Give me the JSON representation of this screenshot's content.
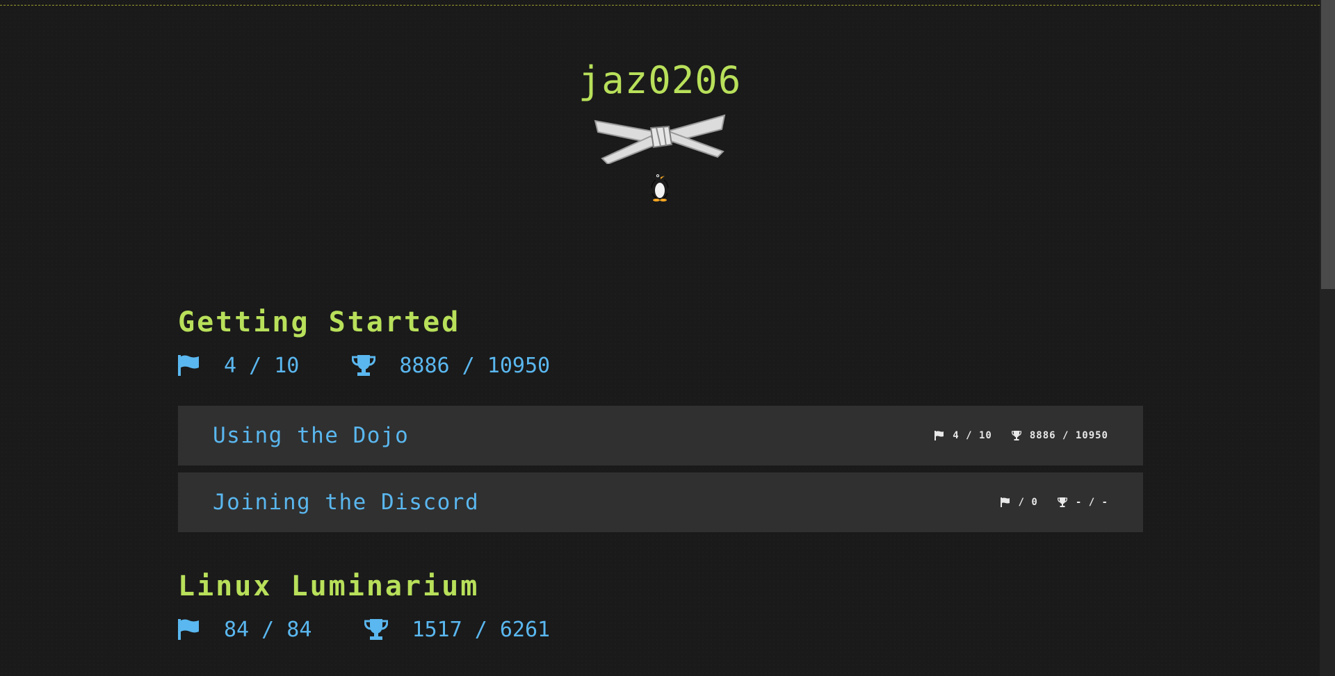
{
  "profile": {
    "username": "jaz0206",
    "belt_icon": "white-belt-icon",
    "emoji_icon": "penguin-icon"
  },
  "modules": [
    {
      "title": "Getting Started",
      "solved": "4 / 10",
      "points": "8886 / 10950",
      "challenges": [
        {
          "title": "Using the Dojo",
          "solved": "4 / 10",
          "points": "8886 / 10950"
        },
        {
          "title": "Joining the Discord",
          "solved": "/ 0",
          "points": "- / -"
        }
      ]
    },
    {
      "title": "Linux Luminarium",
      "solved": "84 / 84",
      "points": "1517 / 6261",
      "challenges": []
    }
  ],
  "colors": {
    "background": "#1a1a1a",
    "accent_green": "#b8e05a",
    "accent_blue": "#5ab7ef",
    "card": "#303030"
  }
}
